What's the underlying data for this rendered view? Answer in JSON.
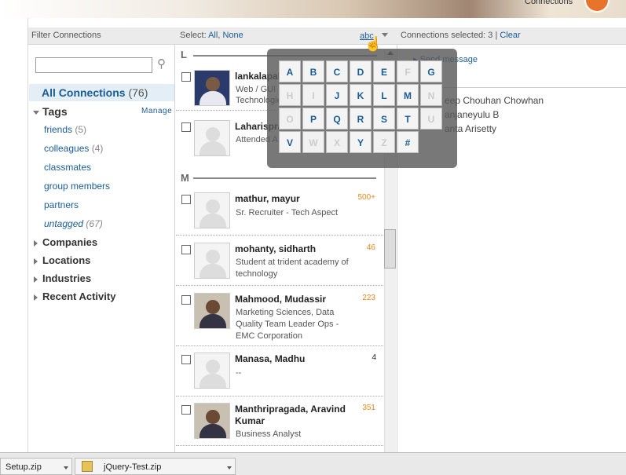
{
  "banner": {
    "connections_label": "Connections"
  },
  "filter": {
    "title": "Filter Connections",
    "search_placeholder": "",
    "all_connections": "All Connections",
    "all_count": "(76)",
    "tags_label": "Tags",
    "manage_label": "Manage",
    "tags": [
      {
        "label": "friends",
        "count": "(5)"
      },
      {
        "label": "colleagues",
        "count": "(4)"
      },
      {
        "label": "classmates",
        "count": ""
      },
      {
        "label": "group members",
        "count": ""
      },
      {
        "label": "partners",
        "count": ""
      },
      {
        "label": "untagged",
        "count": "(67)"
      }
    ],
    "sections": [
      "Companies",
      "Locations",
      "Industries",
      "Recent Activity"
    ]
  },
  "select": {
    "label": "Select:",
    "all": "All",
    "none": "None",
    "abc": "abc"
  },
  "letters_group": [
    "L",
    "M"
  ],
  "contacts": [
    {
      "name": "lankalapal",
      "desc": "Web / GUI D",
      "desc2": "Technologie",
      "count": ""
    },
    {
      "name": "Laharispra",
      "desc": "Attended A",
      "count": ""
    },
    {
      "name": "mathur, mayur",
      "desc": "Sr. Recruiter - Tech Aspect",
      "count": "500+"
    },
    {
      "name": "mohanty, sidharth",
      "desc": "Student at trident academy of technology",
      "count": "46"
    },
    {
      "name": "Mahmood, Mudassir",
      "desc": "Marketing Sciences, Data Quality Team Leader Ops - EMC Corporation",
      "count": "223"
    },
    {
      "name": "Manasa, Madhu",
      "desc": "--",
      "count": "4"
    },
    {
      "name": "Manthripragada, Aravind Kumar",
      "desc": "Business Analyst",
      "count": "351"
    }
  ],
  "picker": {
    "keys": [
      "A",
      "B",
      "C",
      "D",
      "E",
      "F",
      "G",
      "H",
      "I",
      "J",
      "K",
      "L",
      "M",
      "N",
      "O",
      "P",
      "Q",
      "R",
      "S",
      "T",
      "U",
      "V",
      "W",
      "X",
      "Y",
      "Z",
      "#"
    ],
    "disabled": [
      "F",
      "H",
      "I",
      "N",
      "O",
      "U",
      "W",
      "X",
      "Z"
    ]
  },
  "right": {
    "selected_label": "Connections selected: 3 |",
    "clear": "Clear",
    "send_message": "Send message",
    "names": [
      "eep Chouhan Chowhan",
      "anjaneyulu B",
      "anta Arisetty"
    ]
  },
  "taskbar": {
    "items": [
      "Setup.zip",
      "jQuery-Test.zip"
    ]
  }
}
